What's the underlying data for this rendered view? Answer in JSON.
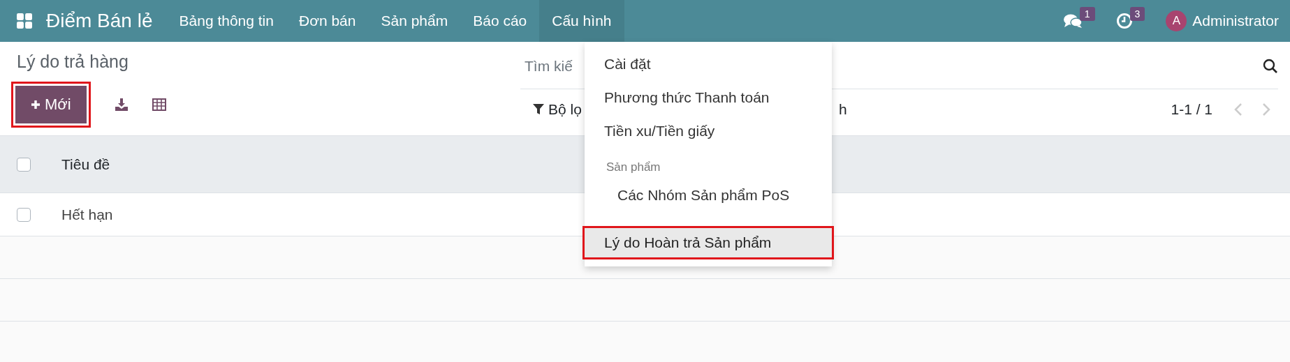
{
  "navbar": {
    "app_name": "Điểm Bán lẻ",
    "menu": [
      {
        "label": "Bảng thông tin",
        "selected": false
      },
      {
        "label": "Đơn bán",
        "selected": false
      },
      {
        "label": "Sản phẩm",
        "selected": false
      },
      {
        "label": "Báo cáo",
        "selected": false
      },
      {
        "label": "Cấu hình",
        "selected": true
      }
    ],
    "messages_count": "1",
    "activities_count": "3",
    "user_initial": "A",
    "user_name": "Administrator"
  },
  "control_panel": {
    "title": "Lý do trả hàng",
    "new_button": {
      "label": "Mới",
      "highlighted": true
    },
    "search": {
      "placeholder": "Tìm kiế"
    },
    "filter_label": "Bộ lọ",
    "filter_tail": "h",
    "pager": "1-1 / 1"
  },
  "table": {
    "columns": [
      {
        "label": "Tiêu đề"
      }
    ],
    "rows": [
      {
        "cells": [
          "Hết hạn"
        ],
        "checked": false
      }
    ],
    "header_checked": false
  },
  "dropdown": {
    "items": [
      {
        "kind": "item",
        "label": "Cài đặt",
        "highlighted": false,
        "selected": false
      },
      {
        "kind": "item",
        "label": "Phương thức Thanh toán",
        "highlighted": false,
        "selected": false
      },
      {
        "kind": "item",
        "label": "Tiền xu/Tiền giấy",
        "highlighted": false,
        "selected": false
      },
      {
        "kind": "header",
        "label": "Sản phẩm"
      },
      {
        "kind": "subitem",
        "label": "Các Nhóm Sản phẩm PoS",
        "highlighted": false,
        "selected": false
      },
      {
        "kind": "item",
        "label": "Lý do Hoàn trả Sản phẩm",
        "highlighted": true,
        "selected": true
      }
    ]
  }
}
